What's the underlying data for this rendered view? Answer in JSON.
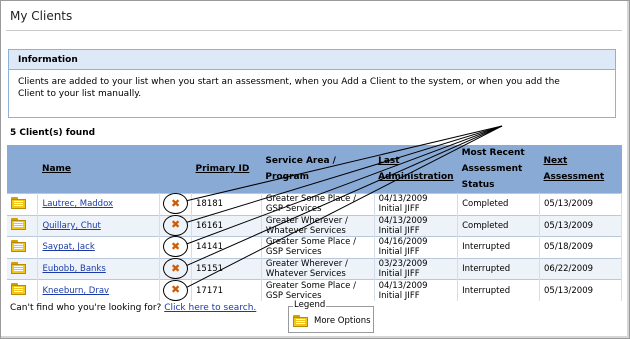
{
  "page": {
    "title": "My Clients"
  },
  "info": {
    "heading": "Information",
    "text": "Clients are added to your list when you start an assessment, when you Add a Client to the system, or when you add the Client to your list manually."
  },
  "client_count": "5 Client(s) found",
  "table": {
    "headers": {
      "name": "Name",
      "primary_id": "Primary ID",
      "service_area": "Service Area / Program",
      "last_admin": "Last Administration",
      "recent_status": "Most Recent Assessment Status",
      "next_assessment": "Next Assessment"
    },
    "rows": [
      {
        "name": "Lautrec, Maddox",
        "id": "18181",
        "service": "Greater Some Place / GSP Services",
        "last_date": "04/13/2009",
        "last_type": "Initial JIFF",
        "status": "Completed",
        "next": "05/13/2009"
      },
      {
        "name": "Quillary, Chut",
        "id": "16161",
        "service": "Greater Wherever / Whatever Services",
        "last_date": "04/13/2009",
        "last_type": "Initial JIFF",
        "status": "Completed",
        "next": "05/13/2009"
      },
      {
        "name": "Saypat, Jack",
        "id": "14141",
        "service": "Greater Some Place / GSP Services",
        "last_date": "04/16/2009",
        "last_type": "Initial JIFF",
        "status": "Interrupted",
        "next": "05/18/2009"
      },
      {
        "name": "Eubobb, Banks",
        "id": "15151",
        "service": "Greater Wherever / Whatever Services",
        "last_date": "03/23/2009",
        "last_type": "Initial JIFF",
        "status": "Interrupted",
        "next": "06/22/2009"
      },
      {
        "name": "Kneeburn, Drav",
        "id": "17171",
        "service": "Greater Some Place / GSP Services",
        "last_date": "04/13/2009",
        "last_type": "Initial JIFF",
        "status": "Interrupted",
        "next": "05/13/2009"
      }
    ],
    "delete_icon": "orange-x-icon",
    "options_icon": "folder-document-icon"
  },
  "footer": {
    "prompt": "Can't find who you're looking for?",
    "search_link": "Click here to search."
  },
  "legend": {
    "title": "Legend",
    "item_label": "More Options"
  },
  "colors": {
    "header_bg": "#8aaad6",
    "info_header_bg": "#dde9f7",
    "link": "#1a3aa8",
    "delete_icon": "#d25a00",
    "folder": "#f3c61c"
  }
}
